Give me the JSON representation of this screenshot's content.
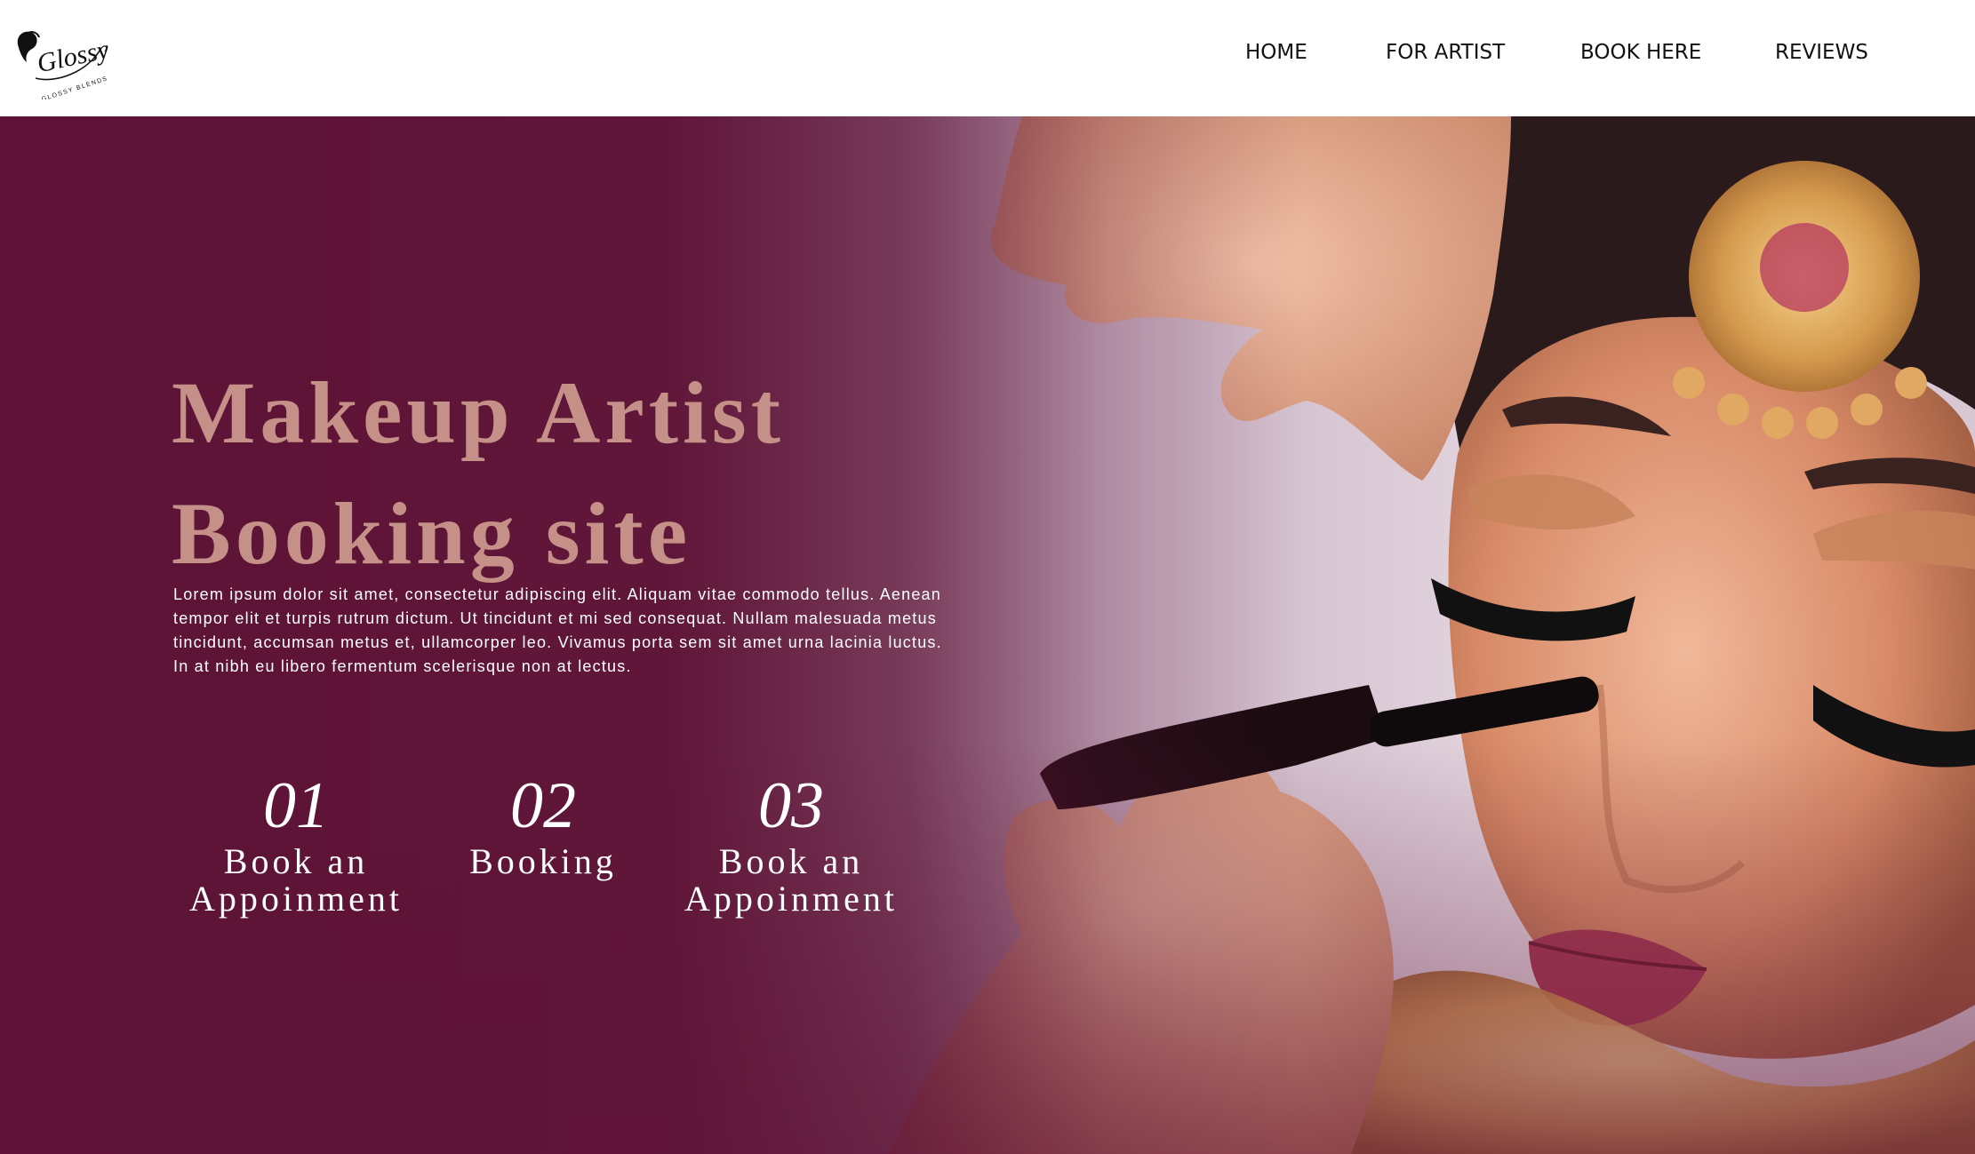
{
  "brand": {
    "logo_script": "Glossy",
    "logo_tagline": "GLOSSY BLENDS"
  },
  "nav": {
    "items": [
      {
        "label": "HOME"
      },
      {
        "label": "FOR ARTIST"
      },
      {
        "label": "BOOK HERE"
      },
      {
        "label": "REVIEWS"
      }
    ]
  },
  "hero": {
    "title_line1": "Makeup Artist",
    "title_line2": "Booking site",
    "description": "Lorem ipsum dolor sit amet, consectetur adipiscing elit. Aliquam vitae commodo tellus. Aenean tempor elit et turpis rutrum dictum. Ut tincidunt et mi sed consequat. Nullam malesuada metus tincidunt, accumsan metus et, ullamcorper leo. Vivamus porta sem sit amet urna lacinia luctus. In at nibh eu libero fermentum scelerisque non at lectus.",
    "photo_subject": "bride-mascara-application-photo",
    "steps": [
      {
        "number": "01",
        "label_line1": "Book an",
        "label_line2": "Appoinment"
      },
      {
        "number": "02",
        "label_line1": "Booking",
        "label_line2": ""
      },
      {
        "number": "03",
        "label_line1": "Book an",
        "label_line2": "Appoinment"
      }
    ]
  },
  "colors": {
    "hero_overlay": "#5e1336",
    "title": "#c49088",
    "nav_text": "#111111",
    "header_bg": "#ffffff"
  }
}
